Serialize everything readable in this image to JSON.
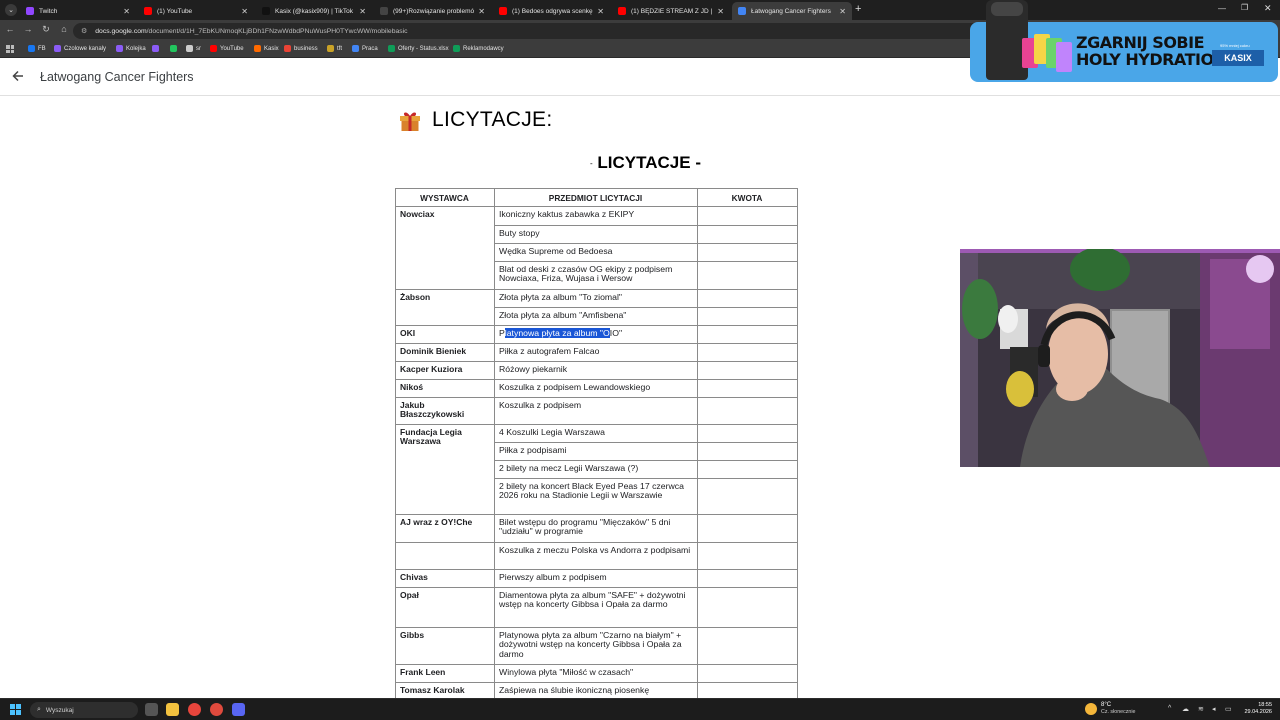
{
  "browser": {
    "tabs": [
      {
        "title": "Twitch",
        "color": "#9147ff",
        "active": false
      },
      {
        "title": "(1) YouTube",
        "color": "#ff0000",
        "active": false
      },
      {
        "title": "Kasix (@kasix909) | TikTok",
        "color": "#111111",
        "active": false
      },
      {
        "title": "(99+)Rozwiązanie problemów z...",
        "color": "#444444",
        "active": false
      },
      {
        "title": "(1) Bedoes odgrywa scenkę z ci...",
        "color": "#ff0000",
        "active": false
      },
      {
        "title": "(1) BĘDZIE STREAM Z JD | ZAG...",
        "color": "#ff0000",
        "active": false
      },
      {
        "title": "Łatwogang Cancer Fighters",
        "color": "#4285f4",
        "active": true
      }
    ],
    "new_tab": "+",
    "url_host": "docs.google.com",
    "url_path": "/document/d/1H_7EbKUNmoqKLjBDh1FNzwWdbdPNuWusPH0TYwcWW/mobilebasic",
    "bookmarks": [
      {
        "label": "FB",
        "color": "#1877f2"
      },
      {
        "label": "Czolowe kanaly",
        "color": "#8b5cf6"
      },
      {
        "label": "Kolejka",
        "color": "#8b5cf6"
      },
      {
        "label": "",
        "color": "#8b5cf6"
      },
      {
        "label": "",
        "color": "#22c55e"
      },
      {
        "label": "sr",
        "color": "#cccccc"
      },
      {
        "label": "YouTube",
        "color": "#ff0000"
      },
      {
        "label": "Kasix",
        "color": "#ff6a00"
      },
      {
        "label": "business",
        "color": "#ea4335"
      },
      {
        "label": "tft",
        "color": "#c9a227"
      },
      {
        "label": "Praca",
        "color": "#4285f4"
      },
      {
        "label": "Oferty - Status.xlsx",
        "color": "#0f9d58"
      },
      {
        "label": "Reklamodawcy",
        "color": "#0f9d58"
      }
    ]
  },
  "docs": {
    "title": "Łatwogang Cancer Fighters"
  },
  "document": {
    "heading": "LICYTACJE:",
    "subheading_dash_left": "-",
    "subheading": "LICYTACJE -",
    "table": {
      "headers": [
        "WYSTAWCA",
        "PRZEDMIOT LICYTACJI",
        "KWOTA"
      ],
      "rows": [
        {
          "who": "Nowciax",
          "item": "Ikoniczny kaktus zabawka z EKIPY"
        },
        {
          "who": "",
          "item": "Buty stopy"
        },
        {
          "who": "",
          "item": "Wędka Supreme od Bedoesa"
        },
        {
          "who": "",
          "item": "Blat od deski z czasów OG ekipy z podpisem Nowciaxa, Friza, Wujasa i Wersow"
        },
        {
          "who": "Żabson",
          "item": "Złota płyta za album \"To ziomal\""
        },
        {
          "who": "",
          "item": "Złota płyta za album \"Amfisbena\""
        },
        {
          "who": "OKI",
          "item_pre": "P",
          "item_hl": "latynowa płyta za album \"O",
          "item_post": "IO\""
        },
        {
          "who": "Dominik Bieniek",
          "item": "Piłka z autografem Falcao"
        },
        {
          "who": "Kacper Kuziora",
          "item": "Różowy piekarnik"
        },
        {
          "who": "Nikoś",
          "item": "Koszulka z podpisem Lewandowskiego"
        },
        {
          "who": "Jakub Błaszczykowski",
          "item": "Koszulka z podpisem"
        },
        {
          "who": "Fundacja Legia Warszawa",
          "item": "4 Koszulki Legia Warszawa"
        },
        {
          "who": "",
          "item": "Piłka z podpisami"
        },
        {
          "who": "",
          "item": "2 bilety na mecz Legii Warszawa (?)"
        },
        {
          "who": "",
          "item": "2 bilety na koncert Black Eyed Peas 17 czerwca 2026 roku na Stadionie Legii w Warszawie"
        },
        {
          "who": "AJ wraz z OY!Che",
          "item": "Bilet wstępu do programu \"Mięczaków\" 5 dni \"udziału\" w programie"
        },
        {
          "who": "",
          "item": "Koszulka z meczu Polska vs Andorra z podpisami"
        },
        {
          "who": "Chivas",
          "item": "Pierwszy album z podpisem"
        },
        {
          "who": "Opał",
          "item": "Diamentowa płyta za album \"SAFE\" + dożywotni wstęp na koncerty Gibbsa i Opała za darmo"
        },
        {
          "who": "Gibbs",
          "item": "Platynowa płyta za album \"Czarno na białym\" + dożywotni wstęp na koncerty Gibbsa i Opała za darmo"
        },
        {
          "who": "Frank Leen",
          "item": "Winylowa płyta \"Miłość w czasach\""
        },
        {
          "who": "Tomasz Karolak",
          "item": "Zaśpiewa na ślubie ikoniczną piosenkę"
        }
      ]
    }
  },
  "ad": {
    "headline_1": "ZGARNIJ SOBIE",
    "headline_2": "HOLY HYDRATION",
    "small": "95% mniej cukru",
    "brand": "KASIX"
  },
  "taskbar": {
    "search_placeholder": "Wyszukaj",
    "weather_temp": "8°C",
    "weather_desc": "Cz. słonecznie",
    "time": "18:55",
    "date": "29.04.2026"
  }
}
